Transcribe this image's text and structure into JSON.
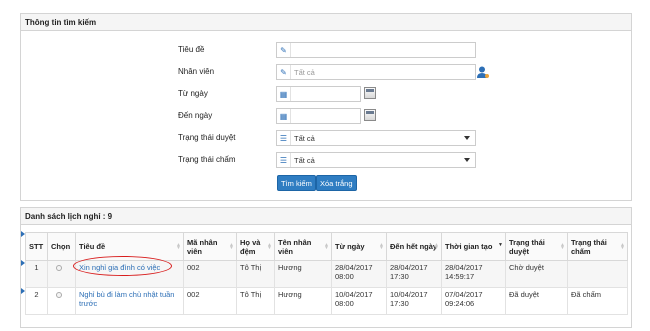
{
  "search": {
    "title": "Thông tin tìm kiếm",
    "fields": [
      {
        "label": "Tiêu đề",
        "value": "",
        "placeholder": ""
      },
      {
        "label": "Nhân viên",
        "value": "",
        "placeholder": "Tất cả"
      },
      {
        "label": "Từ ngày",
        "value": ""
      },
      {
        "label": "Đến ngày",
        "value": ""
      },
      {
        "label": "Trạng thái duyệt",
        "value": "Tất cả"
      },
      {
        "label": "Trạng thái chấm",
        "value": "Tất cả"
      }
    ],
    "search_button": "Tìm kiếm",
    "clear_button": "Xóa trắng"
  },
  "list": {
    "title": "Danh sách lịch nghỉ : 9",
    "columns": [
      "STT",
      "Chọn",
      "Tiêu đề",
      "Mã nhân viên",
      "Họ và đệm",
      "Tên nhân viên",
      "Từ ngày",
      "Đến hết ngày",
      "Thời gian tạo",
      "Trạng thái duyệt",
      "Trạng thái chấm"
    ],
    "rows": [
      {
        "stt": "1",
        "title": "Xin nghỉ gia đình có việc",
        "code": "002",
        "ho": "Tô Thị",
        "ten": "Hương",
        "from": "28/04/2017 08:00",
        "to": "28/04/2017 17:30",
        "created": "28/04/2017 14:59:17",
        "approve": "Chờ duyệt",
        "check": ""
      },
      {
        "stt": "2",
        "title": "Nghỉ bù đi làm chủ nhật tuần trước",
        "code": "002",
        "ho": "Tô Thị",
        "ten": "Hương",
        "from": "10/04/2017 08:00",
        "to": "10/04/2017 17:30",
        "created": "07/04/2017 09:24:06",
        "approve": "Đã duyệt",
        "check": "Đã chấm"
      }
    ]
  },
  "colors": {
    "accent": "#2f7dc2",
    "link": "#2d6fb6",
    "highlight": "#d81e1e"
  }
}
